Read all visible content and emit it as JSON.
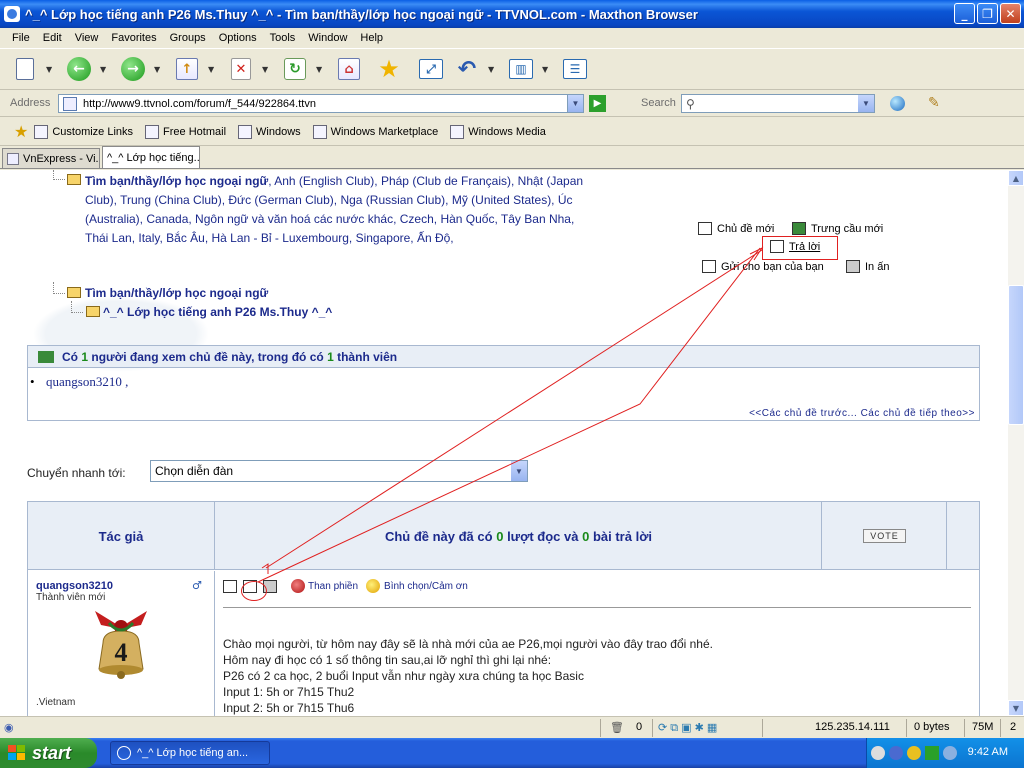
{
  "window": {
    "title": "^_^ Lớp học tiếng anh P26 Ms.Thuy ^_^ - Tìm bạn/thầy/lớp học ngoại ngữ - TTVNOL.com - Maxthon Browser",
    "min_label": "_",
    "max_label": "❐",
    "close_label": "✕"
  },
  "menu": [
    "File",
    "Edit",
    "View",
    "Favorites",
    "Groups",
    "Options",
    "Tools",
    "Window",
    "Help"
  ],
  "address": {
    "label": "Address",
    "url": "http://www9.ttvnol.com/forum/f_544/922864.ttvn"
  },
  "search": {
    "label": "Search",
    "value": ""
  },
  "links": {
    "items": [
      "Customize Links",
      "Free Hotmail",
      "Windows",
      "Windows Marketplace",
      "Windows Media"
    ]
  },
  "tabs": [
    {
      "label": "VnExpress - Vi...",
      "active": false
    },
    {
      "label": "^_^ Lớp học tiếng...",
      "active": true
    }
  ],
  "content": {
    "forum_list_bold": "Tìm bạn/thầy/lớp học ngoại ngữ",
    "forum_list_rest": ", Anh (English Club), Pháp (Club de Français), Nhật (Japan Club), Trung (China Club), Đức (German Club), Nga (Russian Club), Mỹ (United States), Úc (Australia), Canada, Ngôn ngữ và văn hoá các nước khác, Czech, Hàn Quốc, Tây Ban Nha, Thái Lan, Italy, Bắc Âu, Hà Lan - Bỉ - Luxembourg, Singapore, Ấn Độ,",
    "breadcrumb_parent": "Tìm bạn/thầy/lớp học ngoại ngữ",
    "breadcrumb_current": "^_^ Lớp học tiếng anh P26 Ms.Thuy ^_^",
    "actions": {
      "new_topic": "Chủ đề mới",
      "new_poll": "Trưng cầu mới",
      "reply": "Trả lời",
      "send_friend": "Gửi cho bạn của bạn",
      "print": "In ấn"
    },
    "viewers": {
      "prefix": "Có",
      "count": "1",
      "middle": "người đang xem chủ đề này, trong đó có",
      "members": "1",
      "suffix": "thành viên",
      "user": "quangson3210 ,",
      "prevnext": "<<Các chủ đề trước... Các chủ đề tiếp theo>>"
    },
    "quickjump": {
      "label": "Chuyển nhanh tới:",
      "value": "Chọn diễn đàn"
    },
    "table": {
      "author_header": "Tác giả",
      "topic_prefix": "Chủ đề này đã có",
      "reads": "0",
      "topic_mid": "lượt đọc và",
      "replies": "0",
      "topic_suffix": "bài trả lời",
      "vote": "VOTE"
    },
    "post": {
      "author": "quangson3210",
      "role": "Thành viên mới",
      "country": ".Vietnam",
      "complain": "Than phiền",
      "vote_thanks": "Bình chọn/Cảm ơn",
      "lines": [
        "Chào mọi người, từ hôm nay đây sẽ là nhà mới của ae P26,mọi người vào đây trao đổi nhé.",
        "Hôm nay đi học có 1 số thông tin sau,ai lỡ nghỉ thì ghi lại nhé:",
        "P26 có 2 ca học, 2 buổi Input vẫn như ngày xưa chúng ta học Basic",
        "Input 1: 5h or 7h15 Thu2",
        "Input 2: 5h or 7h15 Thu6"
      ]
    }
  },
  "status": {
    "popup_count": "0",
    "ip": "125.235.14.111",
    "bytes": "0 bytes",
    "memory": "75M",
    "tabs_count": "2"
  },
  "taskbar": {
    "start": "start",
    "task": "^_^ Lớp học tiếng an...",
    "clock": "9:42 AM"
  },
  "colors": {
    "xp_blue": "#0b56d6",
    "link_blue": "#1c2a8c",
    "count_green": "#1a8a1a",
    "annotation_red": "#e02020"
  }
}
